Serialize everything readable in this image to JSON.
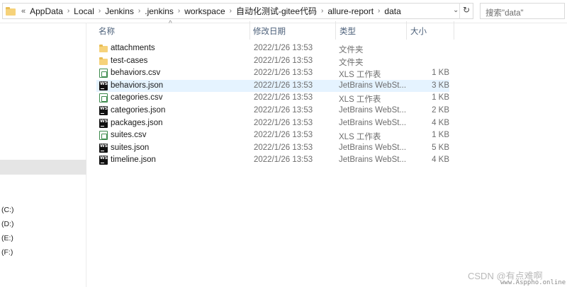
{
  "address_bar": {
    "leading": "«",
    "crumbs": [
      "AppData",
      "Local",
      "Jenkins",
      ".jenkins",
      "workspace",
      "自动化测试-gitee代码",
      "allure-report",
      "data"
    ],
    "separator": "›"
  },
  "search": {
    "placeholder": "搜索\"data\""
  },
  "nav": {
    "drives": [
      "(C:)",
      "(D:)",
      "(E:)",
      "(F:)"
    ]
  },
  "columns": {
    "name": "名称",
    "date": "修改日期",
    "type": "类型",
    "size": "大小"
  },
  "files": [
    {
      "name": "attachments",
      "date": "2022/1/26 13:53",
      "type": "文件夹",
      "size": "",
      "icon": "folder-icon"
    },
    {
      "name": "test-cases",
      "date": "2022/1/26 13:53",
      "type": "文件夹",
      "size": "",
      "icon": "folder-icon"
    },
    {
      "name": "behaviors.csv",
      "date": "2022/1/26 13:53",
      "type": "XLS 工作表",
      "size": "1 KB",
      "icon": "csv-file-icon"
    },
    {
      "name": "behaviors.json",
      "date": "2022/1/26 13:53",
      "type": "JetBrains WebSt...",
      "size": "3 KB",
      "icon": "webstorm-file-icon"
    },
    {
      "name": "categories.csv",
      "date": "2022/1/26 13:53",
      "type": "XLS 工作表",
      "size": "1 KB",
      "icon": "csv-file-icon"
    },
    {
      "name": "categories.json",
      "date": "2022/1/26 13:53",
      "type": "JetBrains WebSt...",
      "size": "2 KB",
      "icon": "webstorm-file-icon"
    },
    {
      "name": "packages.json",
      "date": "2022/1/26 13:53",
      "type": "JetBrains WebSt...",
      "size": "4 KB",
      "icon": "webstorm-file-icon"
    },
    {
      "name": "suites.csv",
      "date": "2022/1/26 13:53",
      "type": "XLS 工作表",
      "size": "1 KB",
      "icon": "csv-file-icon"
    },
    {
      "name": "suites.json",
      "date": "2022/1/26 13:53",
      "type": "JetBrains WebSt...",
      "size": "5 KB",
      "icon": "webstorm-file-icon"
    },
    {
      "name": "timeline.json",
      "date": "2022/1/26 13:53",
      "type": "JetBrains WebSt...",
      "size": "4 KB",
      "icon": "webstorm-file-icon"
    }
  ],
  "watermark": {
    "text": "CSDN @有点难啊",
    "url": "www.Asppho.online"
  },
  "colors": {
    "header_text": "#4c607a",
    "row_hover": "#e5f3ff",
    "nav_selected": "#e5e5e5"
  }
}
